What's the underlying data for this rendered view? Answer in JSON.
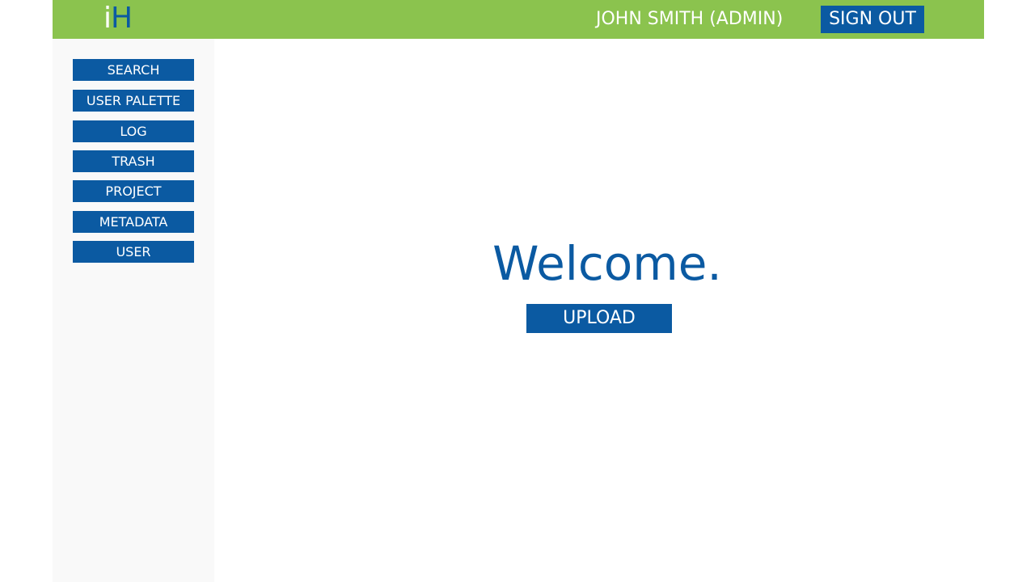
{
  "colors": {
    "header_bg": "#8bc34e",
    "primary": "#0b5aa2",
    "sidebar_bg": "#f9f9f9",
    "text_on_primary": "#ffffff"
  },
  "header": {
    "logo_i": "i",
    "logo_h": "H",
    "user_label": "JOHN SMITH (ADMIN)",
    "sign_out_label": "SIGN OUT"
  },
  "sidebar": {
    "items": [
      {
        "label": "SEARCH"
      },
      {
        "label": "USER PALETTE"
      },
      {
        "label": "LOG"
      },
      {
        "label": "TRASH"
      },
      {
        "label": "PROJECT"
      },
      {
        "label": "METADATA"
      },
      {
        "label": "USER"
      }
    ]
  },
  "main": {
    "welcome_text": "Welcome.",
    "upload_label": "UPLOAD"
  }
}
